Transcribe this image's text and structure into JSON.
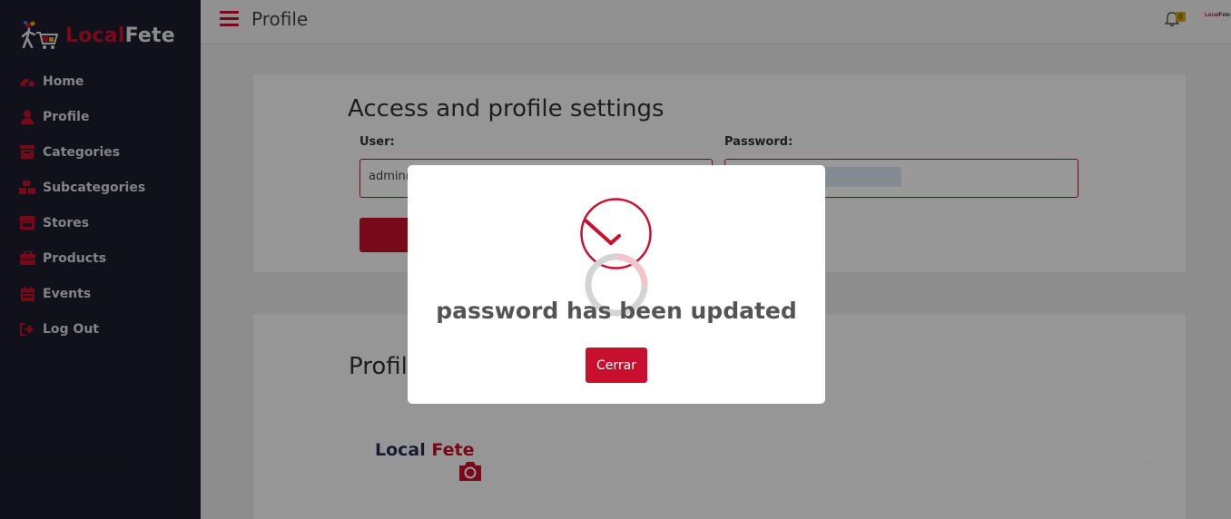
{
  "brand": {
    "part1": "Local",
    "part2": "Fete",
    "colors": {
      "accent": "#c8102e",
      "sidebar": "#1b1d2e"
    }
  },
  "sidebar": {
    "items": [
      {
        "label": "Home",
        "icon": "dashboard-gauge-icon"
      },
      {
        "label": "Profile",
        "icon": "user-icon"
      },
      {
        "label": "Categories",
        "icon": "archive-box-icon"
      },
      {
        "label": "Subcategories",
        "icon": "boxes-icon"
      },
      {
        "label": "Stores",
        "icon": "store-icon"
      },
      {
        "label": "Products",
        "icon": "briefcase-icon"
      },
      {
        "label": "Events",
        "icon": "calendar-icon"
      },
      {
        "label": "Log Out",
        "icon": "sign-out-icon"
      }
    ]
  },
  "header": {
    "title": "Profile",
    "notification_count": "0",
    "mini_logo_part1": "Local",
    "mini_logo_part2": "Fete"
  },
  "access": {
    "title": "Access and profile settings",
    "user_label": "User:",
    "user_value": "admin@",
    "password_label": "Password:"
  },
  "profile": {
    "title": "Profil",
    "logo_part1": "Local",
    "logo_part2": "Fete"
  },
  "modal": {
    "title": "password has been updated",
    "close_label": "Cerrar"
  }
}
